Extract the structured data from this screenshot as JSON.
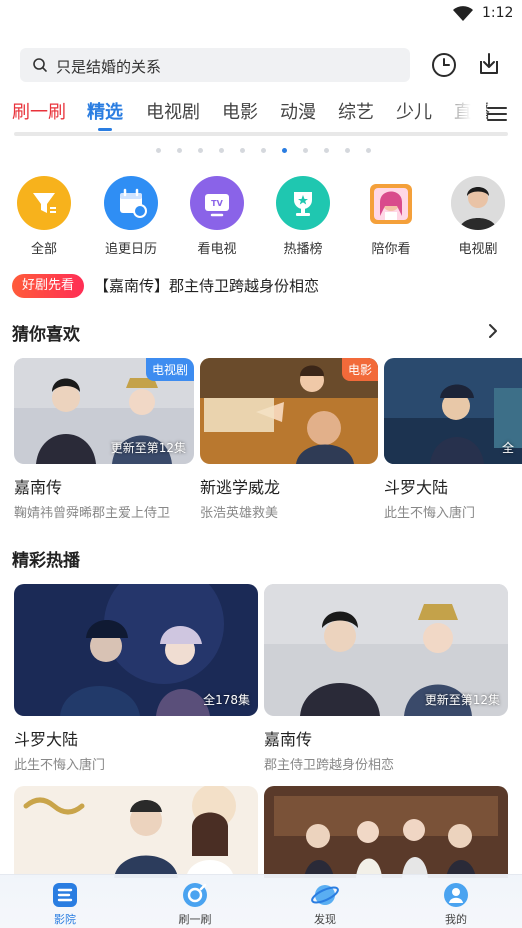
{
  "status": {
    "time": "1:12"
  },
  "search": {
    "placeholder": "只是结婚的关系"
  },
  "tabs": [
    {
      "label": "刷一刷"
    },
    {
      "label": "精选"
    },
    {
      "label": "电视剧"
    },
    {
      "label": "电影"
    },
    {
      "label": "动漫"
    },
    {
      "label": "综艺"
    },
    {
      "label": "少儿"
    },
    {
      "label": "直播"
    }
  ],
  "carousel": {
    "total": 11,
    "active_index": 6
  },
  "quick_entries": [
    {
      "label": "全部",
      "icon": "funnel-icon",
      "color": "#f7b21c"
    },
    {
      "label": "追更日历",
      "icon": "calendar-icon",
      "color": "#2f8ef4"
    },
    {
      "label": "看电视",
      "icon": "tv-icon",
      "color": "#8a63e8"
    },
    {
      "label": "热播榜",
      "icon": "trophy-icon",
      "color": "#1fc7b0"
    },
    {
      "label": "陪你看",
      "icon": "companion-avatar-icon",
      "color": "#f4a03a"
    },
    {
      "label": "电视剧",
      "icon": "actor-avatar-icon",
      "color": "#6e6e6e"
    }
  ],
  "notice": {
    "tag": "好剧先看",
    "text": "【嘉南传】郡主侍卫跨越身份相恋"
  },
  "guess": {
    "title": "猜你喜欢",
    "cards": [
      {
        "type_badge": "电视剧",
        "episode": "更新至第12集",
        "title": "嘉南传",
        "subtitle": "鞠婧祎曾舜晞郡主爱上侍卫"
      },
      {
        "type_badge": "电影",
        "episode": "",
        "title": "新逃学威龙",
        "subtitle": "张浩英雄救美"
      },
      {
        "type_badge": "",
        "episode": "全",
        "title": "斗罗大陆",
        "subtitle": "此生不悔入唐门"
      }
    ]
  },
  "hot": {
    "title": "精彩热播",
    "cards": [
      {
        "episode": "全178集",
        "title": "斗罗大陆",
        "subtitle": "此生不悔入唐门"
      },
      {
        "episode": "更新至第12集",
        "title": "嘉南传",
        "subtitle": "郡主侍卫跨越身份相恋"
      }
    ]
  },
  "nav": [
    {
      "label": "影院",
      "active": true
    },
    {
      "label": "刷一刷",
      "active": false
    },
    {
      "label": "发现",
      "active": false
    },
    {
      "label": "我的",
      "active": false
    }
  ],
  "colors": {
    "accent": "#2a7de1",
    "brand_red": "#e8323a"
  }
}
